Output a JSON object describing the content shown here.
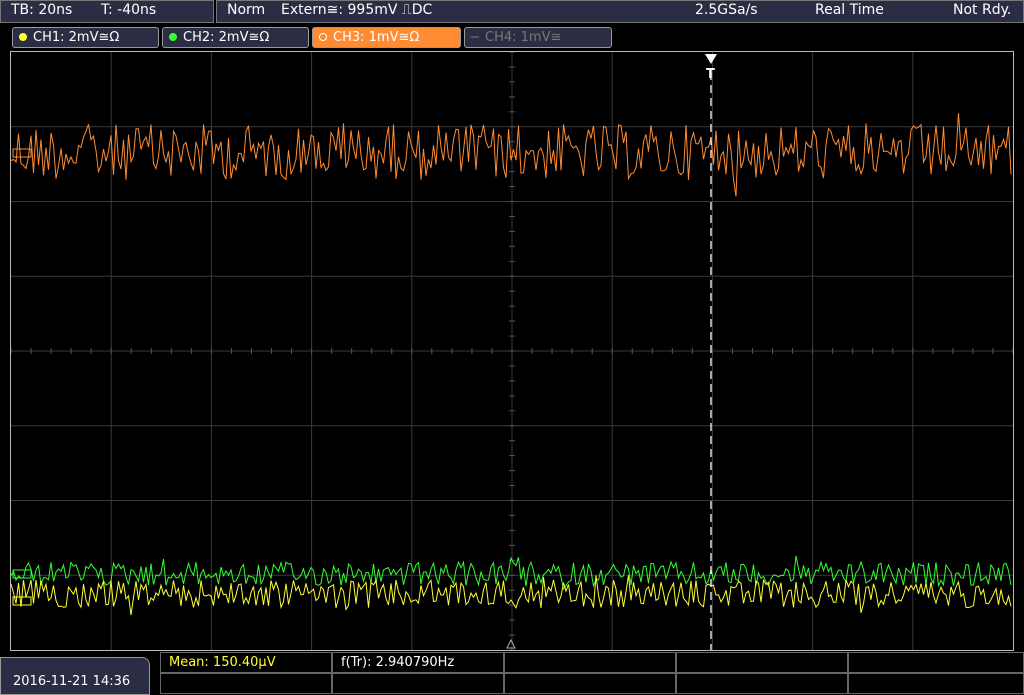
{
  "topbar": {
    "timebase": "TB: 20ns",
    "trig_time": "T: -40ns",
    "mode": "Norm",
    "trigger": "Extern≅: 995mV ⎍DC",
    "sample_rate": "2.5GSa/s",
    "acq_mode": "Real Time",
    "status": "Not Rdy."
  },
  "channels": [
    {
      "label": "CH1: 2mV≅Ω",
      "color": "#ffff33",
      "active": true
    },
    {
      "label": "CH2: 2mV≅Ω",
      "color": "#33ff33",
      "active": true
    },
    {
      "label": "CH3: 1mV≅Ω",
      "color": "#ff8c33",
      "active": true,
      "selected": true
    },
    {
      "label": "CH4: 1mV≅",
      "color": "#777777",
      "active": false
    }
  ],
  "trigger_marker": "T",
  "bottom": {
    "datetime": "2016-11-21 14:36",
    "mean": "Mean: 150.40µV",
    "freq": "f(Tr): 2.940790Hz"
  },
  "colors": {
    "ch1": "#ffff33",
    "ch2": "#33ff33",
    "ch3": "#ff8c33",
    "grid": "#444444",
    "panel": "#2b2d44"
  }
}
